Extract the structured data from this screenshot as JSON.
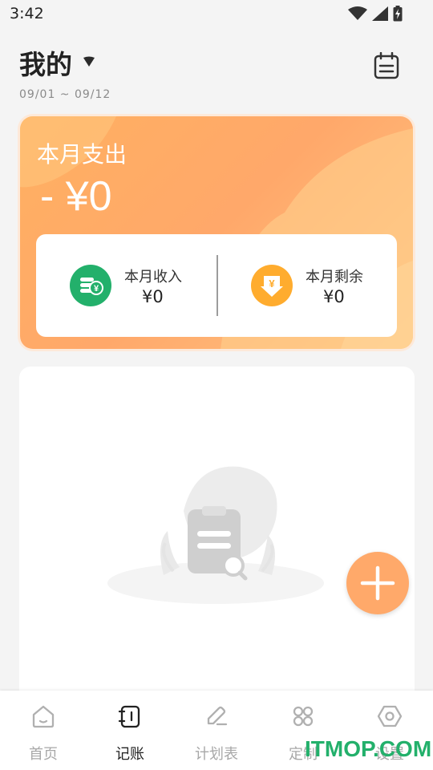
{
  "status_bar": {
    "time": "3:42",
    "icons": [
      "wifi-icon",
      "cell-signal-icon",
      "battery-charging-icon"
    ]
  },
  "header": {
    "title": "我的",
    "date_range": "09/01 ~ 09/12",
    "dropdown_icon": "caret-down-icon",
    "calendar_icon": "calendar-icon"
  },
  "summary": {
    "expense_label": "本月支出",
    "expense_amount": "- ¥0",
    "income_label": "本月收入",
    "income_value": "¥0",
    "remaining_label": "本月剩余",
    "remaining_value": "¥0",
    "colors": {
      "card_gradient_start": "#ffb061",
      "card_gradient_end": "#ffc583",
      "income_icon_bg": "#23b06b",
      "remaining_icon_bg": "#ffac2e"
    }
  },
  "records": {
    "empty_icon": "empty-notes-search-icon"
  },
  "fab": {
    "icon": "plus-icon",
    "color": "#ffa96a"
  },
  "bottom_nav": {
    "items": [
      {
        "label": "首页",
        "icon": "home-icon"
      },
      {
        "label": "记账",
        "icon": "notebook-icon",
        "active": true
      },
      {
        "label": "计划表",
        "icon": "edit-pen-icon"
      },
      {
        "label": "定制",
        "icon": "grid-icon"
      },
      {
        "label": "设置",
        "icon": "settings-hex-icon"
      }
    ]
  },
  "watermark": "ITMOP.COM"
}
